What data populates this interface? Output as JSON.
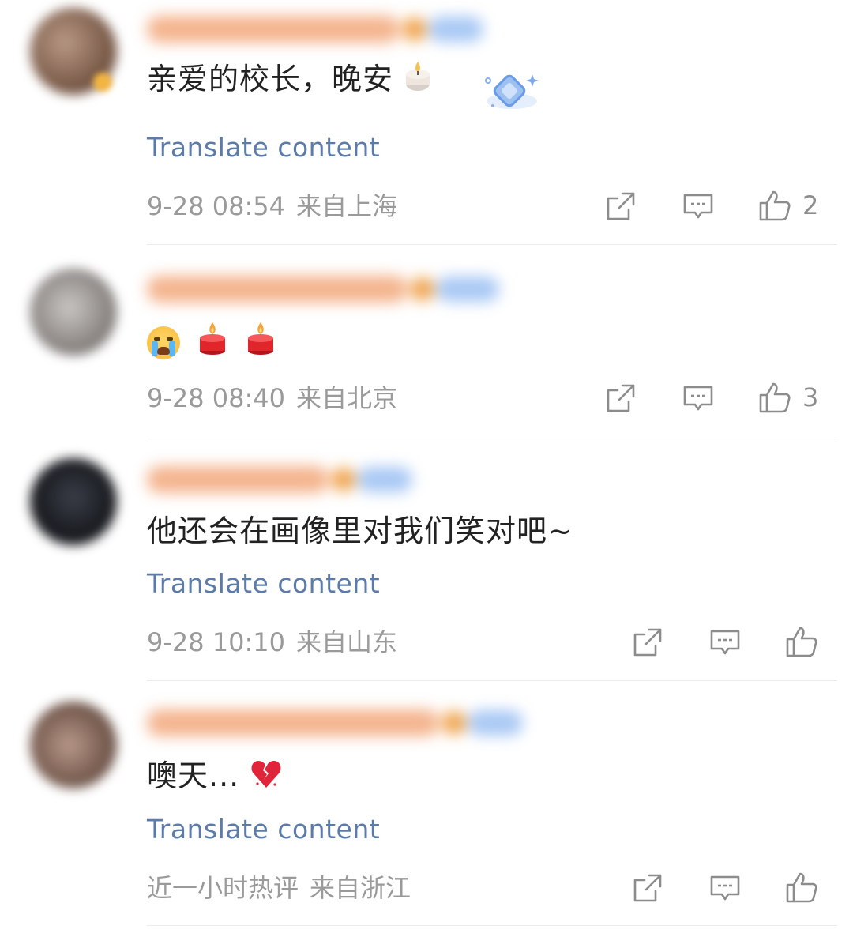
{
  "comments": [
    {
      "text": "亲爱的校长，晚安",
      "translate_label": "Translate content",
      "time": "9-28 08:54",
      "location": "来自上海",
      "like_count": "2",
      "avatar_color": "#8a6a54",
      "emoji": "candle-white"
    },
    {
      "text": "",
      "translate_label": "",
      "time": "9-28 08:40",
      "location": "来自北京",
      "like_count": "3",
      "avatar_color": "#9a9694",
      "emoji_row": [
        "crying-face",
        "red-candle",
        "red-candle"
      ]
    },
    {
      "text": "他还会在画像里对我们笑对吧~",
      "translate_label": "Translate content",
      "time": "9-28 10:10",
      "location": "来自山东",
      "like_count": "",
      "avatar_color": "#1b1d22"
    },
    {
      "text": "噢天...",
      "translate_label": "Translate content",
      "time": "近一小时热评",
      "location": "来自浙江",
      "like_count": "",
      "avatar_color": "#7a5e52",
      "emoji": "broken-heart"
    }
  ],
  "icons": {
    "share": "share-icon",
    "comment": "comment-icon",
    "like": "thumbs-up-icon"
  },
  "colors": {
    "translate_link": "#5b7cab",
    "meta_text": "#9a9a9a",
    "username_blur": "#f4b48e",
    "level_pill": "#a8c8f4"
  }
}
